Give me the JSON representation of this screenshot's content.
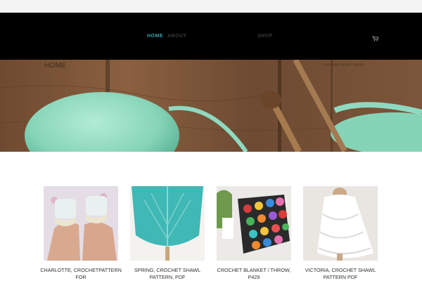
{
  "nav": {
    "home": "HOME",
    "about": "ABOUT",
    "shop": "SHOP",
    "cart_icon": "shopping-cart-icon"
  },
  "hero": {
    "title": "HOME",
    "breadcrumb": "YOU ARE HERE: HOME"
  },
  "products": [
    {
      "title": "CHARLOTTE, CROCHETPATTERN FOR",
      "image": "lace-cuffs-on-hands"
    },
    {
      "title": "SPRING, CROCHET SHAWL PATTERN, PDF",
      "image": "turquoise-shawl"
    },
    {
      "title": "CROCHET BLANKET / THROW, P429",
      "image": "granny-hexagon-blanket"
    },
    {
      "title": "VICTORIA, CROCHET SHAWL PATTERN PDF",
      "image": "white-lace-shawl"
    }
  ],
  "colors": {
    "accent": "#3f9fb0",
    "navbar": "#000000",
    "yarn": "#8fd9c0",
    "wood": "#7a5236"
  }
}
